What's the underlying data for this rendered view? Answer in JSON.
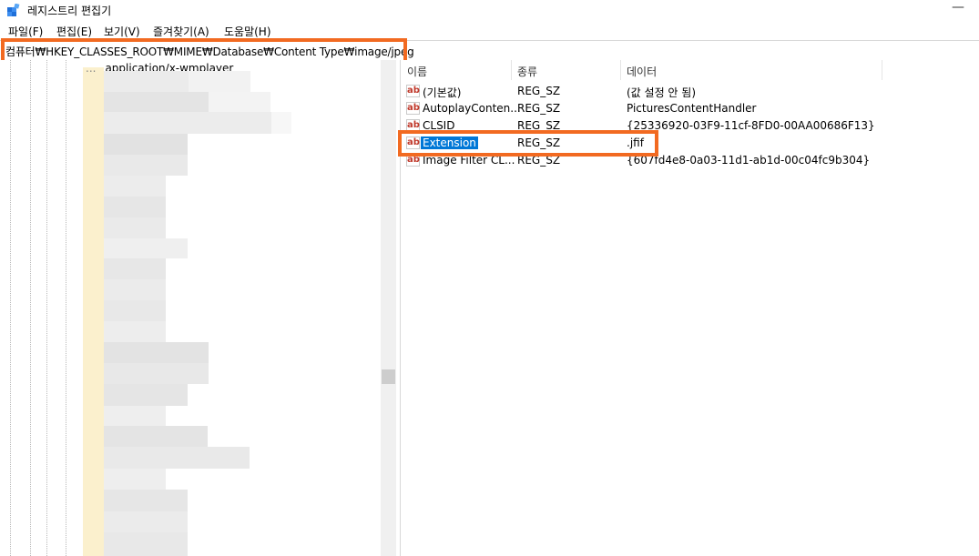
{
  "window": {
    "title": "레지스트리 편집기",
    "minimize_glyph": "—"
  },
  "menu": [
    {
      "label": "파일(F)"
    },
    {
      "label": "편집(E)"
    },
    {
      "label": "보기(V)"
    },
    {
      "label": "즐겨찾기(A)"
    },
    {
      "label": "도움말(H)"
    }
  ],
  "address": {
    "path": "컴퓨터₩HKEY_CLASSES_ROOT₩MIME₩Database₩Content Type₩image/jpeg"
  },
  "tree": {
    "first_item": "application/x-wmplayer",
    "dots": "..."
  },
  "columns": {
    "name": "이름",
    "type": "종류",
    "data": "데이터"
  },
  "values": [
    {
      "name": "(기본값)",
      "type": "REG_SZ",
      "data": "(값 설정 안 됨)",
      "selected": false
    },
    {
      "name": "AutoplayConten...",
      "type": "REG_SZ",
      "data": "PicturesContentHandler",
      "selected": false
    },
    {
      "name": "CLSID",
      "type": "REG_SZ",
      "data": "{25336920-03F9-11cf-8FD0-00AA00686F13}",
      "selected": false
    },
    {
      "name": "Extension",
      "type": "REG_SZ",
      "data": ".jfif",
      "selected": true
    },
    {
      "name": "Image Filter CL...",
      "type": "REG_SZ",
      "data": "{607fd4e8-0a03-11d1-ab1d-00c04fc9b304}",
      "selected": false
    }
  ],
  "icons": {
    "app": "registry-editor-icon",
    "value": "string-value-icon"
  },
  "colors": {
    "highlight": "#f26a21",
    "selection": "#0078d7",
    "folder": "#fbf0cd"
  }
}
